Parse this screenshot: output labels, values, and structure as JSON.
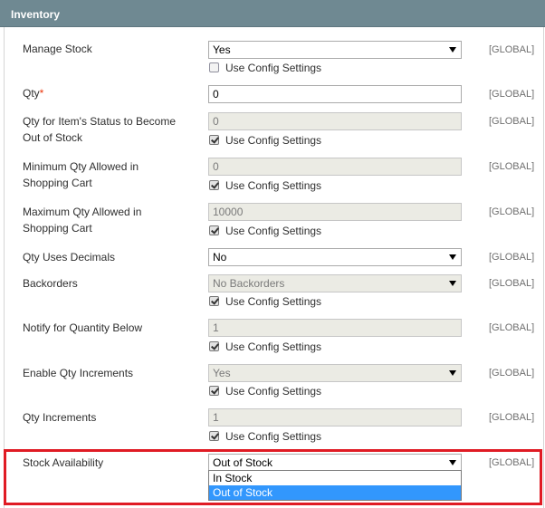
{
  "section": {
    "title": "Inventory"
  },
  "use_config_label": "Use Config Settings",
  "fields": {
    "manage_stock": {
      "label": "Manage Stock",
      "value": "Yes",
      "use_config_checked": false,
      "scope": "[GLOBAL]"
    },
    "qty": {
      "label": "Qty",
      "required_mark": "*",
      "value": "0",
      "scope": "[GLOBAL]"
    },
    "min_qty": {
      "label": "Qty for Item's Status to Become Out of Stock",
      "value": "0",
      "use_config_checked": true,
      "scope": "[GLOBAL]"
    },
    "min_sale_qty": {
      "label": "Minimum Qty Allowed in Shopping Cart",
      "value": "0",
      "use_config_checked": true,
      "scope": "[GLOBAL]"
    },
    "max_sale_qty": {
      "label": "Maximum Qty Allowed in Shopping Cart",
      "value": "10000",
      "use_config_checked": true,
      "scope": "[GLOBAL]"
    },
    "is_qty_decimal": {
      "label": "Qty Uses Decimals",
      "value": "No",
      "scope": "[GLOBAL]"
    },
    "backorders": {
      "label": "Backorders",
      "value": "No Backorders",
      "use_config_checked": true,
      "scope": "[GLOBAL]"
    },
    "notify_stock_qty": {
      "label": "Notify for Quantity Below",
      "value": "1",
      "use_config_checked": true,
      "scope": "[GLOBAL]"
    },
    "enable_qty_increments": {
      "label": "Enable Qty Increments",
      "value": "Yes",
      "use_config_checked": true,
      "scope": "[GLOBAL]"
    },
    "qty_increments": {
      "label": "Qty Increments",
      "value": "1",
      "use_config_checked": true,
      "scope": "[GLOBAL]"
    },
    "stock_availability": {
      "label": "Stock Availability",
      "value": "Out of Stock",
      "scope": "[GLOBAL]",
      "options": [
        "In Stock",
        "Out of Stock"
      ],
      "highlighted_option": "Out of Stock"
    }
  },
  "colors": {
    "header_bg": "#6f8992",
    "highlight_border": "#e01b24",
    "option_selected_bg": "#3297fd"
  },
  "icons": {
    "select_arrow": "chevron-down-icon",
    "checkbox": "checkbox"
  }
}
